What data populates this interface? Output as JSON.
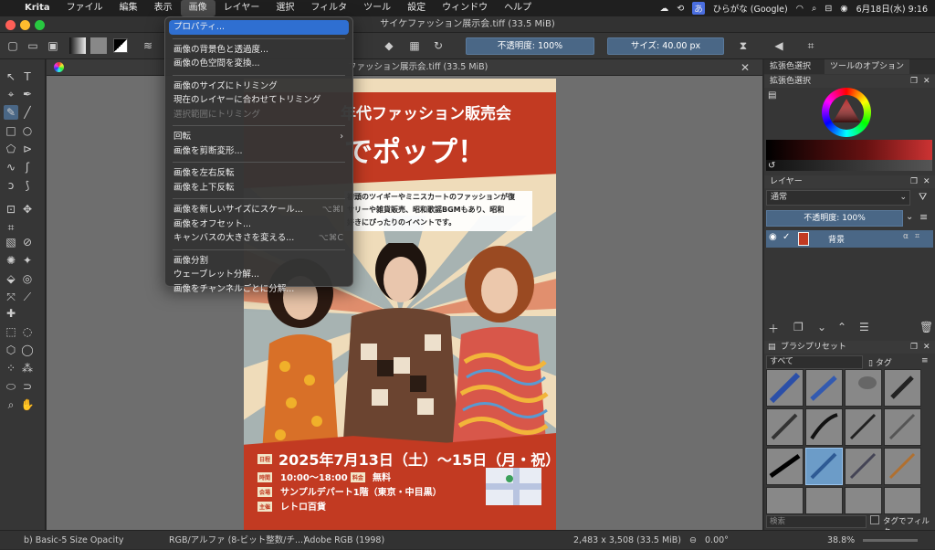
{
  "macos": {
    "menus": [
      "Krita",
      "ファイル",
      "編集",
      "表示",
      "画像",
      "レイヤー",
      "選択",
      "フィルタ",
      "ツール",
      "設定",
      "ウィンドウ",
      "ヘルプ"
    ],
    "input_label": "ひらがな (Google)",
    "clock": "6月18日(水) 9:16"
  },
  "window": {
    "title": "サイケファッション展示会.tiff (33.5 MiB)"
  },
  "toolbar": {
    "opacity": "不透明度: 100%",
    "size": "サイズ: 40.00 px"
  },
  "canvas": {
    "tab_title": "ファッション展示会.tiff (33.5 MiB)"
  },
  "poster": {
    "headline": "年代ファッション販売会",
    "big": "でポップ！",
    "desc1": "初頭のツイギーやミニスカートのファッションが復",
    "desc2": "サリーや雑貨販売、昭和歌謡BGMもあり、昭和",
    "desc3": "好きにぴったりのイベントです。",
    "date_tag": "日程",
    "date": "2025年7月13日（土）〜15日（月・祝）",
    "time_tag": "時間",
    "time": "10:00〜18:00",
    "fee_tag": "料金",
    "fee": "無料",
    "venue_tag": "会場",
    "venue": "サンプルデパート1階（東京・中目黒）",
    "host_tag": "主催",
    "host": "レトロ百貨"
  },
  "image_menu": {
    "items": [
      {
        "label": "プロパティ...",
        "state": "hl"
      },
      {
        "sep": true
      },
      {
        "label": "画像の背景色と透過度..."
      },
      {
        "label": "画像の色空間を変換..."
      },
      {
        "sep": true
      },
      {
        "label": "画像のサイズにトリミング"
      },
      {
        "label": "現在のレイヤーに合わせてトリミング"
      },
      {
        "label": "選択範囲にトリミング",
        "state": "dis"
      },
      {
        "sep": true
      },
      {
        "label": "回転",
        "arrow": "›"
      },
      {
        "label": "画像を剪断変形..."
      },
      {
        "sep": true
      },
      {
        "label": "画像を左右反転"
      },
      {
        "label": "画像を上下反転"
      },
      {
        "sep": true
      },
      {
        "label": "画像を新しいサイズにスケール...",
        "shortcut": "⌥⌘I"
      },
      {
        "label": "画像をオフセット..."
      },
      {
        "label": "キャンバスの大きさを変える...",
        "shortcut": "⌥⌘C"
      },
      {
        "sep": true
      },
      {
        "label": "画像分割"
      },
      {
        "label": "ウェーブレット分解..."
      },
      {
        "label": "画像をチャンネルごとに分解..."
      }
    ]
  },
  "dockers": {
    "tab_selector": "拡張色選択",
    "tab_tool": "ツールのオプション",
    "color_title": "拡張色選択",
    "layers_title": "レイヤー",
    "blend": "通常",
    "layer_opacity": "不透明度: 100%",
    "layer_name": "背景",
    "presets_title": "ブラシプリセット",
    "preset_filter": "すべて",
    "tag_label": "タグ",
    "search_placeholder": "検索",
    "tag_filter": "タグでフィルタ"
  },
  "status": {
    "brush": "b) Basic-5 Size Opacity",
    "color": "RGB/アルファ (8-ビット整数/チ...)",
    "profile": "Adobe RGB (1998)",
    "dims": "2,483 x 3,508 (33.5 MiB)",
    "rotation": "0.00°",
    "zoom": "38.8%"
  }
}
